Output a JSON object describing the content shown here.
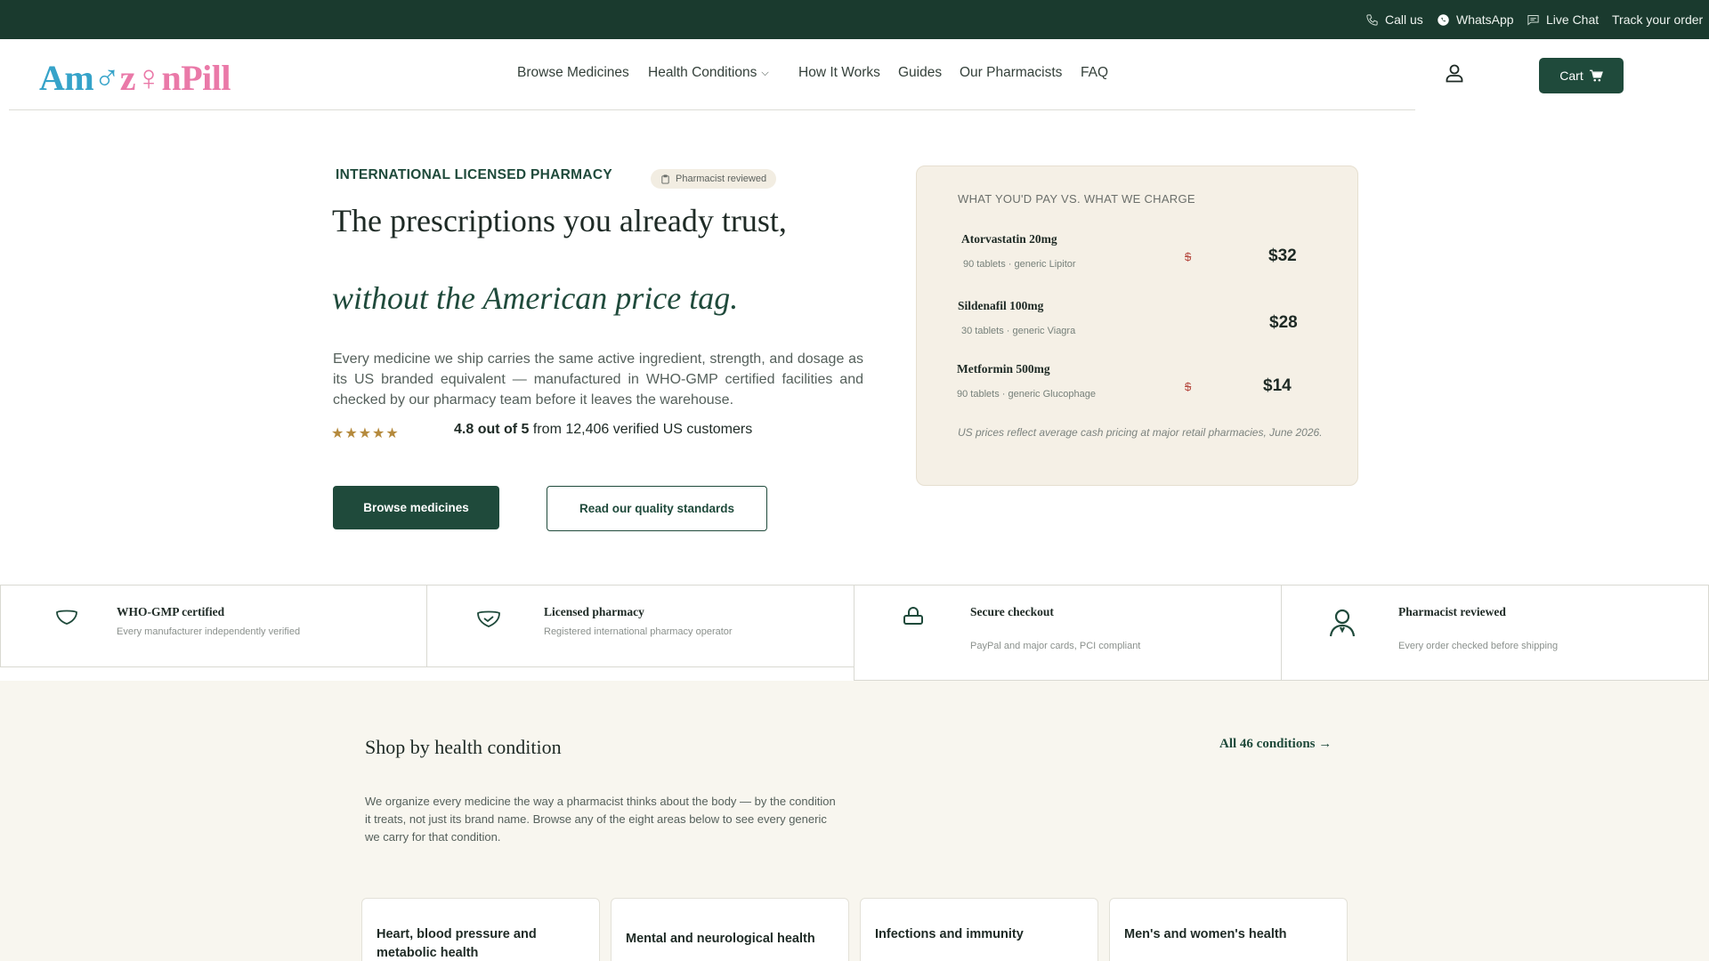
{
  "topbar": {
    "call": "Call us",
    "whatsapp": "WhatsApp",
    "chat": "Live Chat",
    "track": "Track your order"
  },
  "logo": {
    "part1": "Am",
    "part2": "♂",
    "part3": "z",
    "part4": "♀",
    "part5": "nPill"
  },
  "nav": {
    "items": [
      "Browse Medicines",
      "Health Conditions",
      "How It Works",
      "Guides",
      "Our Pharmacists",
      "FAQ"
    ]
  },
  "header": {
    "cart_label": "Cart"
  },
  "hero": {
    "eyebrow": "INTERNATIONAL LICENSED PHARMACY",
    "badge": "Pharmacist reviewed",
    "title": "The prescriptions you already trust,",
    "title_italic": "without the American price tag.",
    "lead": "Every medicine we ship carries the same active ingredient, strength, and dosage as its US branded equivalent — manufactured in WHO-GMP certified facilities and checked by our pharmacy team before it leaves the warehouse.",
    "stars": "★★★★★",
    "rating_bold": "4.8 out of 5",
    "rating_rest": " from 12,406 verified US customers",
    "btn_primary": "Browse medicines",
    "btn_secondary": "Read our quality standards"
  },
  "price_card": {
    "title": "WHAT YOU'D PAY VS. WHAT WE CHARGE",
    "rows": [
      {
        "name": "Atorvastatin 20mg",
        "sub": "90 tablets · generic Lipitor",
        "old": "$",
        "price": "$32"
      },
      {
        "name": "Sildenafil 100mg",
        "sub": "30 tablets · generic Viagra",
        "old": "",
        "price": "$28"
      },
      {
        "name": "Metformin 500mg",
        "sub": "90 tablets · generic Glucophage",
        "old": "$",
        "price": "$14"
      }
    ],
    "note": "US prices reflect average cash pricing at major retail pharmacies, June 2026."
  },
  "trust": [
    {
      "title": "WHO-GMP certified",
      "sub": "Every manufacturer independently verified",
      "icon": "shield-icon"
    },
    {
      "title": "Licensed pharmacy",
      "sub": "Registered international pharmacy operator",
      "icon": "shield-check-icon"
    },
    {
      "title": "Secure checkout",
      "sub": "PayPal and major cards, PCI compliant",
      "icon": "lock-icon"
    },
    {
      "title": "Pharmacist reviewed",
      "sub": "Every order checked before shipping",
      "icon": "pharmacist-icon"
    }
  ],
  "conditions": {
    "title": "Shop by health condition",
    "all_link": "All 46 conditions →",
    "intro": "We organize every medicine the way a pharmacist thinks about the body — by the condition it treats, not just its brand name. Browse any of the eight areas below to see every generic we carry for that condition.",
    "cards": [
      "Heart, blood pressure and metabolic health",
      "Mental and neurological health",
      "Infections and immunity",
      "Men's and women's health"
    ]
  },
  "colors": {
    "brand_dark": "#1f4a3b",
    "topbar": "#1a3a2e",
    "logo_blue": "#36a3c9",
    "logo_pink": "#ea79a8",
    "accent_gold": "#b58a3d",
    "strike_red": "#b5483e",
    "card_bg": "#f5f0e6"
  }
}
